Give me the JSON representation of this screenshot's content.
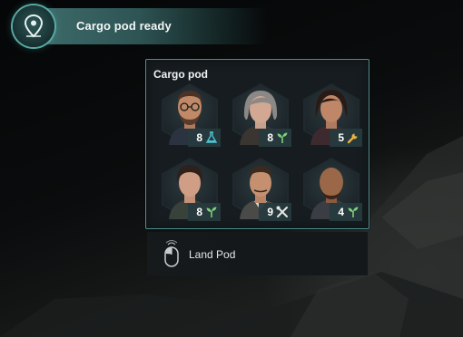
{
  "notification": {
    "icon": "map-pin-icon",
    "text": "Cargo pod ready"
  },
  "pod": {
    "title": "Cargo pod",
    "crew": [
      {
        "skill_level": "8",
        "skill_icon": "flask-icon",
        "skill_color": "#4fc3d0"
      },
      {
        "skill_level": "8",
        "skill_icon": "plant-icon",
        "skill_color": "#7ed07a"
      },
      {
        "skill_level": "5",
        "skill_icon": "wrench-icon",
        "skill_color": "#e8b340"
      },
      {
        "skill_level": "8",
        "skill_icon": "plant-icon",
        "skill_color": "#7ed07a"
      },
      {
        "skill_level": "9",
        "skill_icon": "tools-icon",
        "skill_color": "#e6e6e6"
      },
      {
        "skill_level": "4",
        "skill_icon": "plant-icon",
        "skill_color": "#7ed07a"
      }
    ]
  },
  "action": {
    "icon": "mouse-left-click-icon",
    "label": "Land Pod"
  },
  "colors": {
    "accent": "#4f9090",
    "banner": "#3f6c6c",
    "panel": "#161c1f"
  }
}
